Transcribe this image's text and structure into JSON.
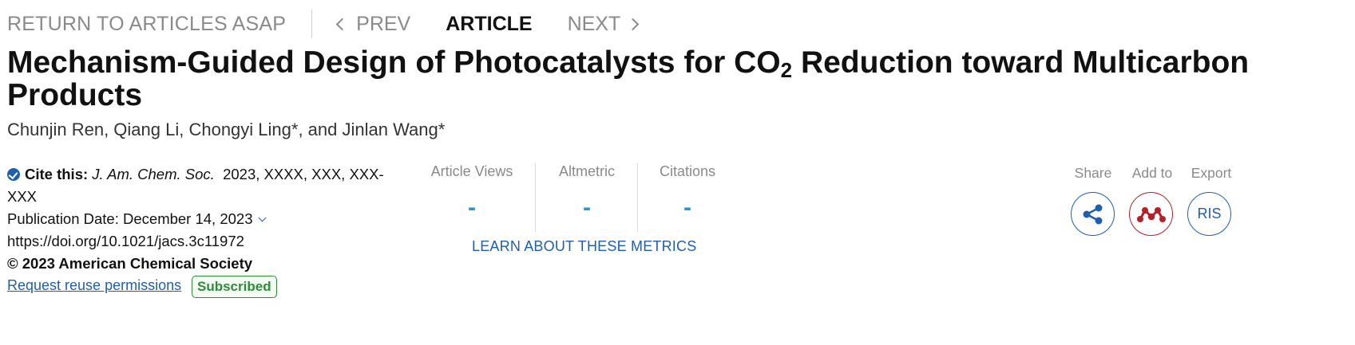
{
  "nav": {
    "return_label": "RETURN TO ARTICLES ASAP",
    "prev_label": "PREV",
    "article_label": "ARTICLE",
    "next_label": "NEXT"
  },
  "article": {
    "title_part1": "Mechanism-Guided Design of Photocatalysts for CO",
    "title_sub": "2",
    "title_part2": " Reduction toward Multicarbon Products",
    "authors": "Chunjin Ren, Qiang Li, Chongyi Ling*, and Jinlan Wang*"
  },
  "cite": {
    "label": "Cite this:",
    "journal": "J. Am. Chem. Soc.",
    "details": "2023, XXXX, XXX, XXX-XXX",
    "publication_date": "Publication Date: December 14, 2023",
    "doi": "https://doi.org/10.1021/jacs.3c11972",
    "copyright": "© 2023 American Chemical Society",
    "reuse_link": "Request reuse permissions",
    "access_badge": "Subscribed"
  },
  "metrics": {
    "items": [
      {
        "label": "Article Views",
        "value": "-"
      },
      {
        "label": "Altmetric",
        "value": "-"
      },
      {
        "label": "Citations",
        "value": "-"
      }
    ],
    "learn_link": "LEARN ABOUT THESE METRICS"
  },
  "actions": {
    "share_label": "Share",
    "add_label": "Add to",
    "export_label": "Export",
    "export_button": "RIS"
  },
  "colors": {
    "link_blue": "#1f5fae",
    "metric_blue": "#1e9bd7",
    "mendeley_red": "#b81f26",
    "subscribed_green": "#2e8b3a",
    "muted_gray": "#8a8a8a"
  },
  "icons": {
    "share": "share-icon",
    "add_to": "mendeley-icon",
    "verified": "check-circle-icon",
    "prev": "chevron-left-icon",
    "next": "chevron-right-icon",
    "date_expand": "chevron-down-icon"
  }
}
